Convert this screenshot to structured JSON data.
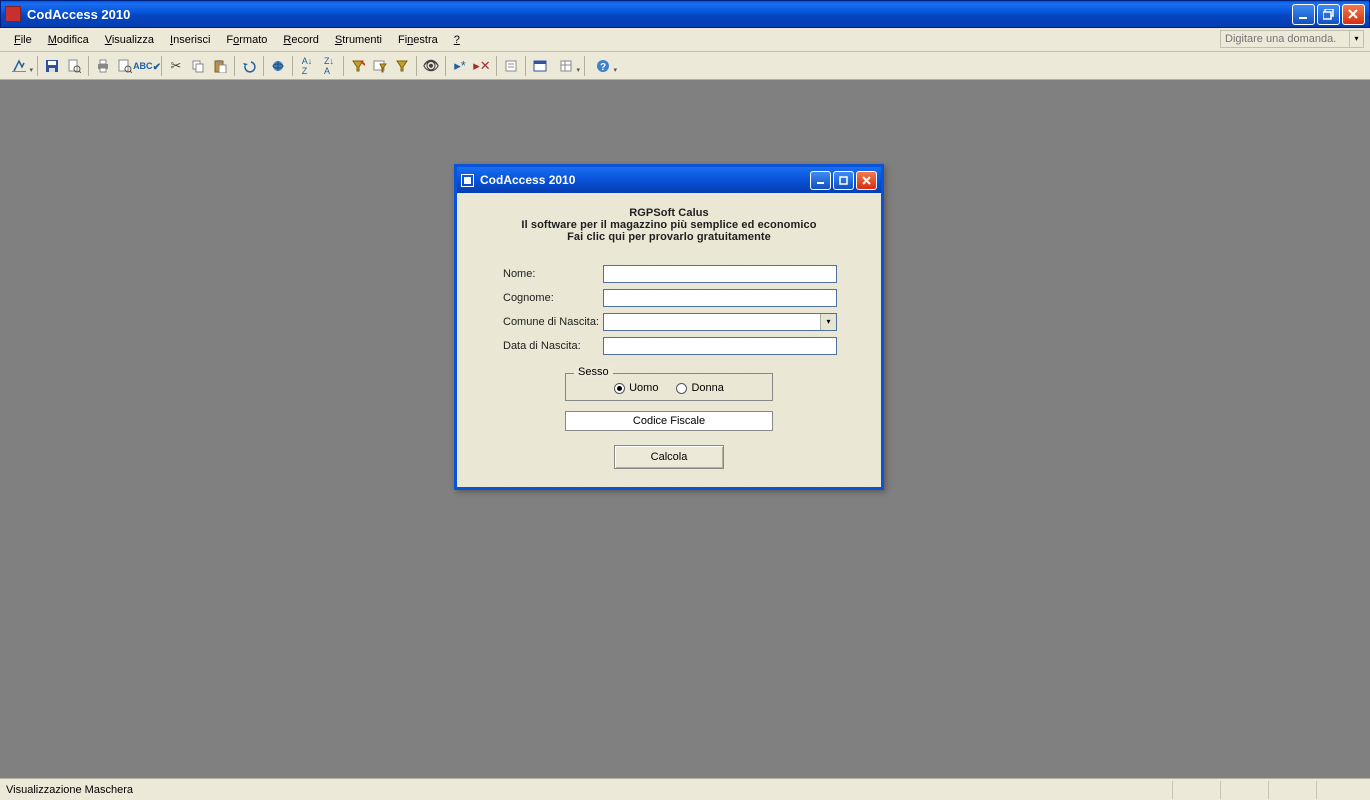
{
  "app": {
    "title": "CodAccess 2010"
  },
  "menus": {
    "file": "File",
    "modifica": "Modifica",
    "visualizza": "Visualizza",
    "inserisci": "Inserisci",
    "formato": "Formato",
    "record": "Record",
    "strumenti": "Strumenti",
    "finestra": "Finestra",
    "help": "?"
  },
  "search": {
    "placeholder": "Digitare una domanda."
  },
  "toolbar_icons": {
    "design_view": "design-view",
    "save": "save",
    "save_as": "file-search",
    "print": "print",
    "print_preview": "print-preview",
    "spellcheck": "spellcheck",
    "cut": "cut",
    "copy": "copy",
    "paste": "paste",
    "undo": "undo",
    "redo": "redo",
    "sort_asc": "sort-asc",
    "sort_desc": "sort-desc",
    "filter_selection": "filter-selection",
    "filter_form": "filter-form",
    "toggle_filter": "toggle-filter",
    "find": "find",
    "new_record": "new-record",
    "delete_record": "delete-record",
    "properties": "properties",
    "db_window": "db-window",
    "new_object": "new-object",
    "help_btn": "help"
  },
  "dialog": {
    "title": "CodAccess 2010",
    "promo_1": "RGPSoft Calus",
    "promo_2": "Il software per il magazzino più semplice ed economico",
    "promo_3": "Fai clic qui per provarlo gratuitamente",
    "labels": {
      "nome": "Nome:",
      "cognome": "Cognome:",
      "comune": "Comune di Nascita:",
      "data": "Data di Nascita:"
    },
    "values": {
      "nome": "",
      "cognome": "",
      "comune": "",
      "data": ""
    },
    "sesso": {
      "legend": "Sesso",
      "uomo": "Uomo",
      "donna": "Donna",
      "selected": "uomo"
    },
    "output_label": "Codice Fiscale",
    "calc_btn": "Calcola"
  },
  "status": {
    "text": "Visualizzazione Maschera"
  }
}
